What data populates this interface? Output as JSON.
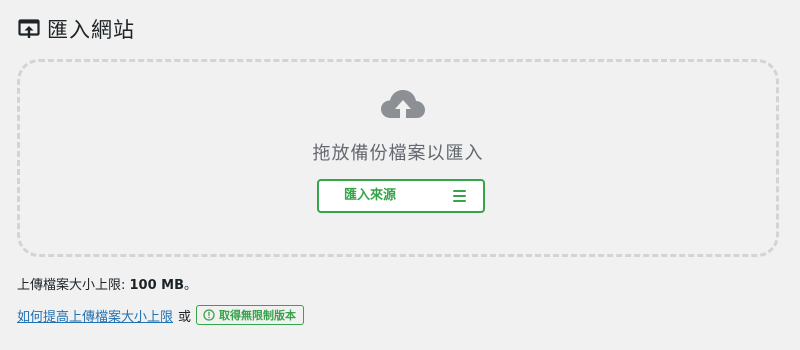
{
  "header": {
    "title": "匯入網站",
    "icon": "import-upload-icon"
  },
  "dropzone": {
    "icon": "cloud-upload-icon",
    "text": "拖放備份檔案以匯入",
    "import_button_label": "匯入來源",
    "menu_icon": "hamburger-menu-icon"
  },
  "limit": {
    "label": "上傳檔案大小上限: ",
    "value": "100 MB",
    "suffix": "。"
  },
  "footer": {
    "link_text": "如何提高上傳檔案大小上限",
    "or_text": "或",
    "unlimited_label": "取得無限制版本",
    "unlimited_icon": "info-circle-icon"
  },
  "colors": {
    "accent_green": "#37a34a",
    "link_blue": "#2271b1",
    "muted_gray": "#646970",
    "background": "#f1f1f1"
  }
}
